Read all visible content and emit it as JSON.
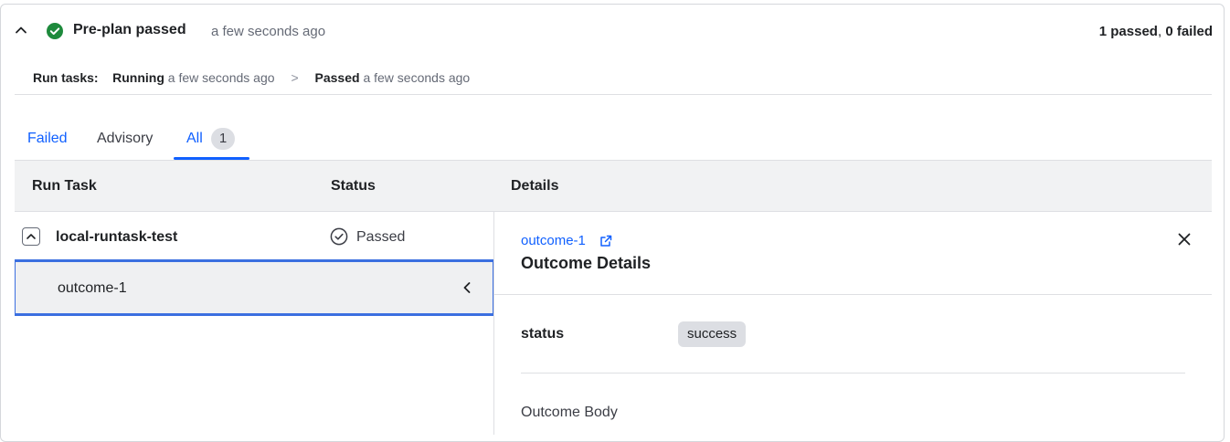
{
  "header": {
    "title": "Pre-plan passed",
    "time": "a few seconds ago",
    "summary_passed": "1 passed",
    "summary_sep": ", ",
    "summary_failed": "0 failed"
  },
  "run_tasks": {
    "label": "Run tasks:",
    "step1_status": "Running",
    "step1_time": " a few seconds ago",
    "arrow": ">",
    "step2_status": "Passed",
    "step2_time": " a few seconds ago"
  },
  "tabs": [
    {
      "label": "Failed"
    },
    {
      "label": "Advisory"
    },
    {
      "label": "All",
      "count": "1"
    }
  ],
  "table": {
    "headers": [
      "Run Task",
      "Status",
      "Details"
    ],
    "rows": [
      {
        "task": "local-runtask-test",
        "status": "Passed",
        "outcome": "outcome-1"
      }
    ]
  },
  "details": {
    "link": "outcome-1",
    "title": "Outcome Details",
    "field_key": "status",
    "field_value": "success",
    "body_label": "Outcome Body"
  },
  "colors": {
    "accent": "#1060ff",
    "success": "#1e8a3c"
  }
}
